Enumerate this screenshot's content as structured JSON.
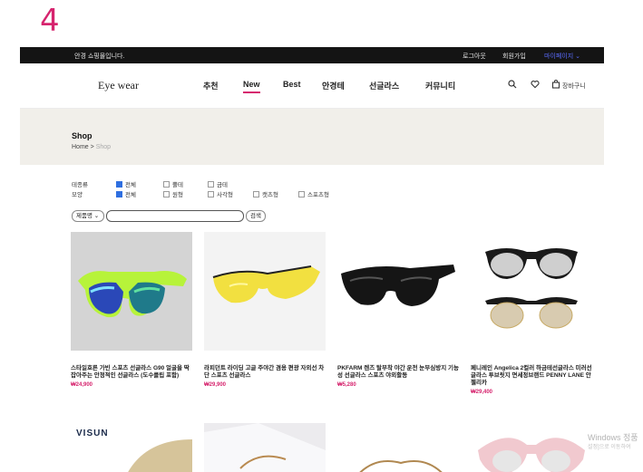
{
  "slide_number": "4",
  "topbar": {
    "welcome": "안경 쇼핑몰입니다.",
    "logout": "로그아웃",
    "signup": "회원가입",
    "mypage": "마이페이지 ⌄"
  },
  "header": {
    "brand": "Eye wear",
    "nav": [
      "추천",
      "New",
      "Best",
      "안경테",
      "선글라스",
      "커뮤니티"
    ],
    "active_nav": "New",
    "cart_label": "장바구니",
    "icons": [
      "search-icon",
      "heart-icon",
      "cart-icon"
    ]
  },
  "hero": {
    "title": "Shop",
    "breadcrumb_home": "Home",
    "breadcrumb_sep": ">",
    "breadcrumb_current": "Shop"
  },
  "filters": {
    "rows": [
      {
        "label": "테종류",
        "options": [
          {
            "label": "전체",
            "checked": true
          },
          {
            "label": "뿔테",
            "checked": false
          },
          {
            "label": "금테",
            "checked": false
          }
        ]
      },
      {
        "label": "모양",
        "options": [
          {
            "label": "전체",
            "checked": true
          },
          {
            "label": "원형",
            "checked": false
          },
          {
            "label": "사각형",
            "checked": false
          },
          {
            "label": "캣츠형",
            "checked": false
          },
          {
            "label": "스포츠형",
            "checked": false
          }
        ]
      }
    ]
  },
  "search": {
    "field_select": "제품명",
    "query": "",
    "button": "검색"
  },
  "products": [
    {
      "name": "스타일호른 가빈 스포츠 선글라스 G90 얼굴을 딱 잡아주는 안정적인 선글라스 (도수클립 포함)",
      "price": "₩24,900"
    },
    {
      "name": "라피던트 라이딩 고글 주야간 겸용 편광 자외선 차단 스포츠 선글라스",
      "price": "₩29,900"
    },
    {
      "name": "PKFARM 렌즈 탈부착 야간 운전 눈부심방지 기능성 선글라스 스포츠 야외활동",
      "price": "₩5,280"
    },
    {
      "name": "페니레인 Angelica 2컬러 하금테선글라스 미러선글라스 투브릿지 면세정브랜드 PENNY LANE 안젤리카",
      "price": "₩29,400"
    }
  ],
  "row2_brand": "VISUN",
  "watermark": {
    "line1": "Windows 정품",
    "line2": "설정]으로 이동하여"
  },
  "colors": {
    "accent": "#d6246e",
    "topbar_bg": "#141414",
    "hero_bg": "#f1efea",
    "link_blue": "#5b6cff",
    "checkbox_on": "#2f6fe0"
  }
}
